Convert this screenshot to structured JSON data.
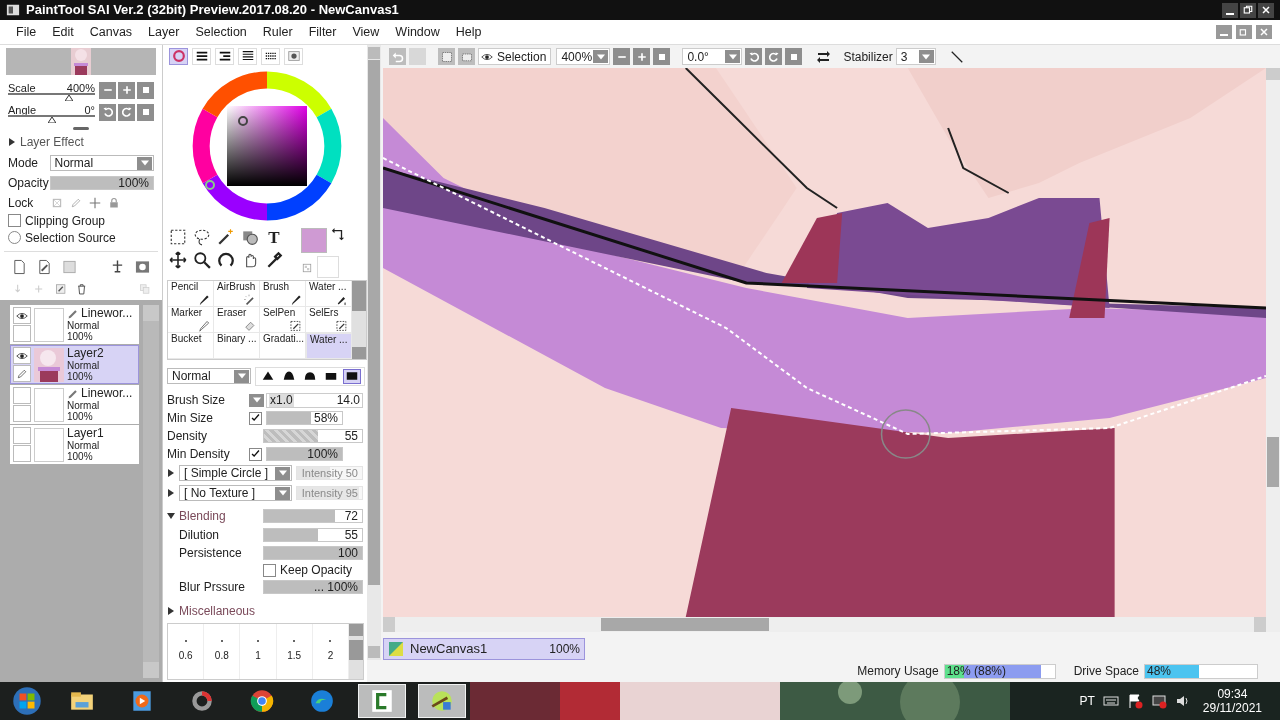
{
  "window": {
    "title": "PaintTool SAI Ver.2 (32bit) Preview.2017.08.20 - NewCanvas1"
  },
  "menu": [
    "File",
    "Edit",
    "Canvas",
    "Layer",
    "Selection",
    "Ruler",
    "Filter",
    "View",
    "Window",
    "Help"
  ],
  "navigator": {
    "scale": {
      "label": "Scale",
      "value": "400%",
      "level": 0.7
    },
    "angle": {
      "label": "Angle",
      "value": "0°",
      "level": 0.5
    }
  },
  "layer_effect": {
    "label": "Layer Effect",
    "expanded": false
  },
  "layer_props": {
    "mode_label": "Mode",
    "mode": "Normal",
    "opacity_label": "Opacity",
    "opacity": {
      "value": "100%",
      "level": 1
    },
    "lock_label": "Lock",
    "clipping_group": {
      "label": "Clipping Group",
      "checked": false
    },
    "selection_source": {
      "label": "Selection Source",
      "checked": false
    }
  },
  "layers": [
    {
      "name": "Linewor...",
      "mode": "Normal",
      "opacity": "100%",
      "kind": "linework",
      "visible": true,
      "selected": false
    },
    {
      "name": "Layer2",
      "mode": "Normal",
      "opacity": "100%",
      "kind": "paint",
      "visible": true,
      "selected": true
    },
    {
      "name": "Linewor...",
      "mode": "Normal",
      "opacity": "100%",
      "kind": "linework",
      "visible": false,
      "selected": false
    },
    {
      "name": "Layer1",
      "mode": "Normal",
      "opacity": "100%",
      "kind": "blank",
      "visible": false,
      "selected": false
    }
  ],
  "color_tabs": [
    {
      "kind": "wheel",
      "selected": true
    },
    {
      "kind": "bars",
      "selected": false
    },
    {
      "kind": "bars2",
      "selected": false
    },
    {
      "kind": "list",
      "selected": false
    },
    {
      "kind": "grid",
      "selected": false
    },
    {
      "kind": "swatch",
      "selected": false
    }
  ],
  "swatch": {
    "color": "#cf9ad3"
  },
  "text_tool": "T",
  "brushes": [
    {
      "name": "Pencil",
      "kind": "pen",
      "selected": false
    },
    {
      "name": "AirBrush",
      "kind": "spray",
      "selected": false
    },
    {
      "name": "Brush",
      "kind": "pen",
      "selected": false
    },
    {
      "name": "Water ...",
      "kind": "drop",
      "selected": false
    },
    {
      "name": "Marker",
      "kind": "outline",
      "selected": false
    },
    {
      "name": "Eraser",
      "kind": "eraser",
      "selected": false
    },
    {
      "name": "SelPen",
      "kind": "select",
      "selected": false
    },
    {
      "name": "SelErs",
      "kind": "select",
      "selected": false
    },
    {
      "name": "Bucket",
      "kind": "none",
      "selected": false
    },
    {
      "name": "Binary ...",
      "kind": "none",
      "selected": false
    },
    {
      "name": "Gradati...",
      "kind": "none",
      "selected": false
    },
    {
      "name": "Water ...",
      "kind": "none",
      "selected": true
    }
  ],
  "blend_mode": "Normal",
  "tips": [
    {
      "kind": "sharp",
      "selected": false
    },
    {
      "kind": "round",
      "selected": false
    },
    {
      "kind": "soft",
      "selected": false
    },
    {
      "kind": "flat",
      "selected": false
    },
    {
      "kind": "full",
      "selected": true
    }
  ],
  "settings": [
    {
      "kind": "size",
      "label": "Brush Size",
      "multiplier": "x1.0",
      "value": "14.0"
    },
    {
      "kind": "check_slider",
      "label": "Min Size",
      "checked": true,
      "value": "58%",
      "level": 0.58
    },
    {
      "kind": "slider",
      "label": "Density",
      "value": "55",
      "level": 0.55,
      "checkered": true
    },
    {
      "kind": "check_slider",
      "label": "Min Density",
      "checked": true,
      "value": "100%",
      "level": 1
    },
    {
      "kind": "dropdown",
      "value": "[ Simple Circle ]",
      "extra": {
        "value": "Intensity 50",
        "level": 0.5,
        "disabled": true
      }
    },
    {
      "kind": "dropdown",
      "value": "[ No Texture ]",
      "extra": {
        "value": "Intensity 95",
        "level": 0.95,
        "disabled": true
      }
    },
    {
      "kind": "section",
      "label": "Blending",
      "expanded": true,
      "value": "72",
      "level": 0.72
    },
    {
      "kind": "slider",
      "label": "Dilution",
      "value": "55",
      "level": 0.55
    },
    {
      "kind": "slider",
      "label": "Persistence",
      "value": "100",
      "level": 1
    },
    {
      "kind": "check",
      "label": "Keep Opacity",
      "checked": false
    },
    {
      "kind": "slider",
      "label": "Blur Prssure",
      "value": "... 100%",
      "level": 1
    },
    {
      "kind": "section",
      "label": "Miscellaneous",
      "expanded": false
    }
  ],
  "presets": [
    "0.6",
    "0.8",
    "1",
    "1.5",
    "2"
  ],
  "canvas_toolbar": {
    "selection": "Selection",
    "zoom": "400%",
    "angle": "0.0°",
    "stabilizer_label": "Stabilizer",
    "stabilizer": "3"
  },
  "canvas_tabs": [
    {
      "name": "NewCanvas1",
      "zoom": "100%",
      "selected": true
    }
  ],
  "status": {
    "memory": {
      "label": "Memory Usage",
      "reading": "18% (88%)",
      "meters": [
        {
          "level": 0.88,
          "color": "#8c9cf0"
        },
        {
          "level": 0.18,
          "color": "#5ee08c"
        }
      ]
    },
    "drive": {
      "label": "Drive Space",
      "reading": "48%",
      "level": 0.48
    }
  },
  "taskbar": {
    "apps": [
      {
        "kind": "folder",
        "active": false
      },
      {
        "kind": "media",
        "active": false
      },
      {
        "kind": "ring",
        "active": false
      },
      {
        "kind": "chrome",
        "active": false
      },
      {
        "kind": "edge",
        "active": false
      },
      {
        "kind": "bracket",
        "active": true
      },
      {
        "kind": "lime",
        "active": true
      }
    ],
    "language": "PT",
    "time": "09:34",
    "date": "29/11/2021"
  }
}
